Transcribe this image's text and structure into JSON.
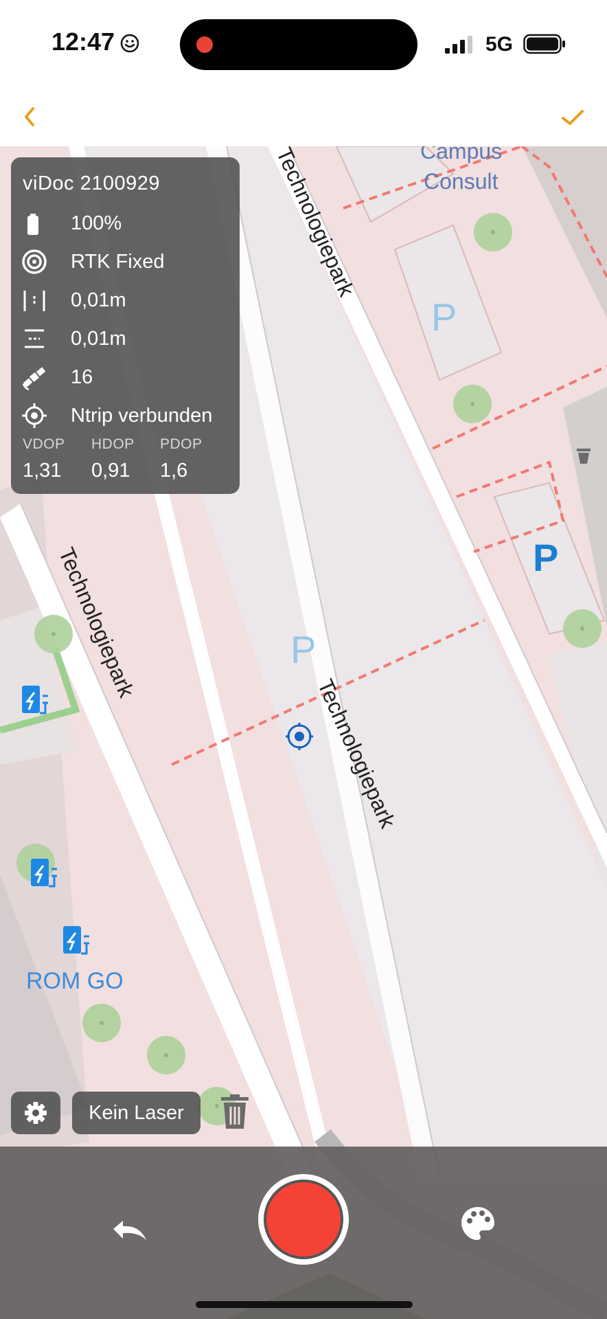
{
  "status_bar": {
    "time": "12:47",
    "network": "5G"
  },
  "header": {
    "back_icon": "chevron-left-icon",
    "confirm_icon": "checkmark-icon",
    "accent": "#e8a020"
  },
  "map": {
    "labels": {
      "street_top": "Technologiepark",
      "street_left": "Technologiepark",
      "street_center": "Technologiepark",
      "poi_line1": "Campus",
      "poi_line2": "Consult",
      "poi_rom": "ROM GO",
      "parking": "P"
    }
  },
  "gnss": {
    "device": "viDoc  2100929",
    "battery": "100%",
    "fix": "RTK Fixed",
    "vertical_accuracy": "0,01m",
    "horizontal_accuracy": "0,01m",
    "satellites": "16",
    "ntrip": "Ntrip verbunden",
    "dop": [
      {
        "label": "VDOP",
        "value": "1,31"
      },
      {
        "label": "HDOP",
        "value": "0,91"
      },
      {
        "label": "PDOP",
        "value": "1,6"
      }
    ]
  },
  "controls": {
    "laser_label": "Kein Laser",
    "record_color": "#f44336"
  }
}
